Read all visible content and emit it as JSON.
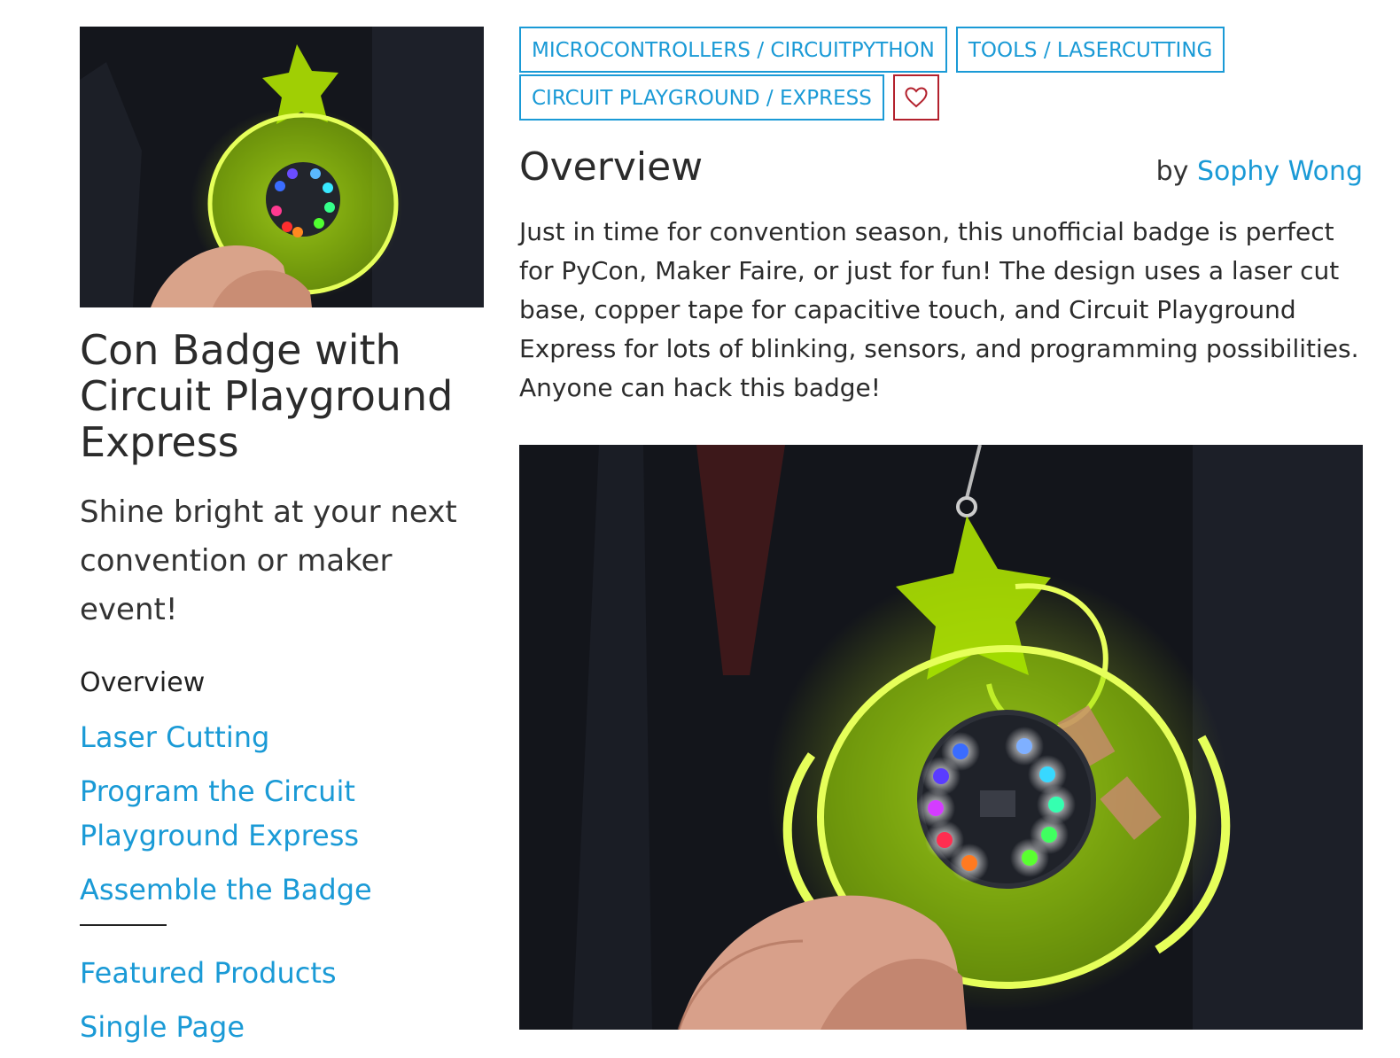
{
  "guide": {
    "title": "Con Badge with Circuit Playground Express",
    "subtitle": "Shine bright at your next convention or maker event!"
  },
  "toc": {
    "current": "Overview",
    "items": [
      "Laser Cutting",
      "Program the Circuit Playground Express",
      "Assemble the Badge"
    ],
    "extra_items": [
      "Featured Products",
      "Single Page"
    ]
  },
  "tags": [
    "MICROCONTROLLERS / CIRCUITPYTHON",
    "TOOLS / LASERCUTTING",
    "CIRCUIT PLAYGROUND / EXPRESS"
  ],
  "page": {
    "heading": "Overview",
    "byline_prefix": "by",
    "author": "Sophy Wong",
    "intro": "Just in time for convention season, this unofficial badge is perfect for PyCon, Maker Faire, or just for fun! The design uses a laser cut base, copper tape for capacitive touch, and Circuit Playground Express for lots of blinking, sensors, and programming possibilities. Anyone can hack this badge!"
  },
  "icons": {
    "favorite": "heart-outline-icon"
  },
  "colors": {
    "link": "#1a9ad6",
    "favorite": "#b3212d",
    "text": "#2b2b2b",
    "acrylic": "#c6ff00"
  }
}
